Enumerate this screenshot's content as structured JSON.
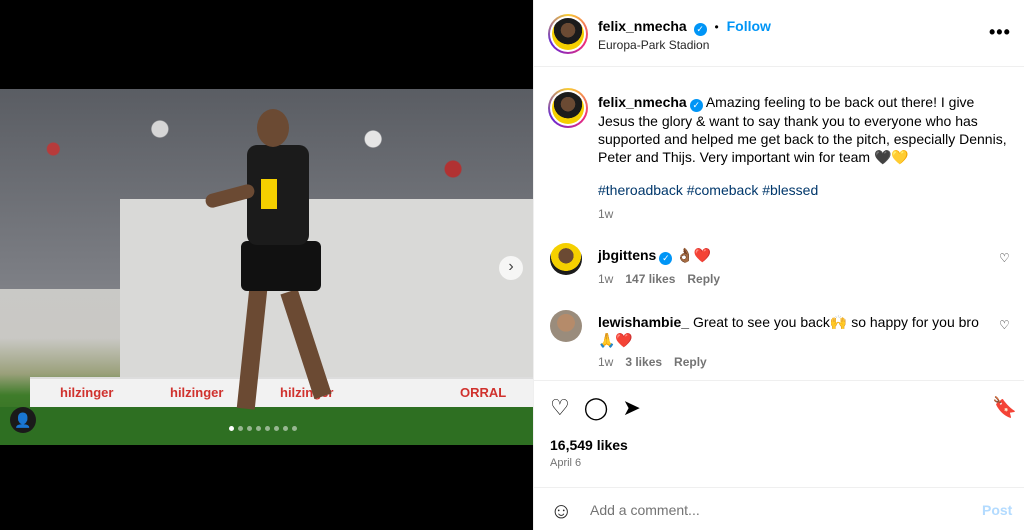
{
  "media": {
    "board_texts": [
      "hilzinger",
      "hilzinger",
      "hilzinger",
      "ORRAL"
    ],
    "slide_count": 8,
    "active_slide": 1
  },
  "header": {
    "username": "felix_nmecha",
    "separator": "•",
    "follow_label": "Follow",
    "location": "Europa-Park Stadion",
    "more_label": "•••"
  },
  "caption": {
    "username": "felix_nmecha",
    "text": "Amazing feeling to be back out there! I give Jesus the glory & want to say thank you to everyone who has supported and helped me get back to the pitch, especially Dennis, Peter and Thijs. Very important win for team 🖤💛",
    "hashtags": "#theroadback #comeback #blessed",
    "time": "1w"
  },
  "comments": [
    {
      "username": "jbgittens",
      "text": "👌🏾❤️",
      "time": "1w",
      "likes": "147 likes",
      "reply": "Reply"
    },
    {
      "username": "lewishambie_",
      "text": "Great to see you back🙌 so happy for you bro 🙏❤️",
      "time": "1w",
      "likes": "3 likes",
      "reply": "Reply"
    }
  ],
  "actions": {
    "likes": "16,549 likes",
    "date": "April 6"
  },
  "composer": {
    "placeholder": "Add a comment...",
    "post_label": "Post"
  },
  "colors": {
    "accent": "#0095f6",
    "hashtag": "#00376b",
    "muted": "#737373"
  }
}
